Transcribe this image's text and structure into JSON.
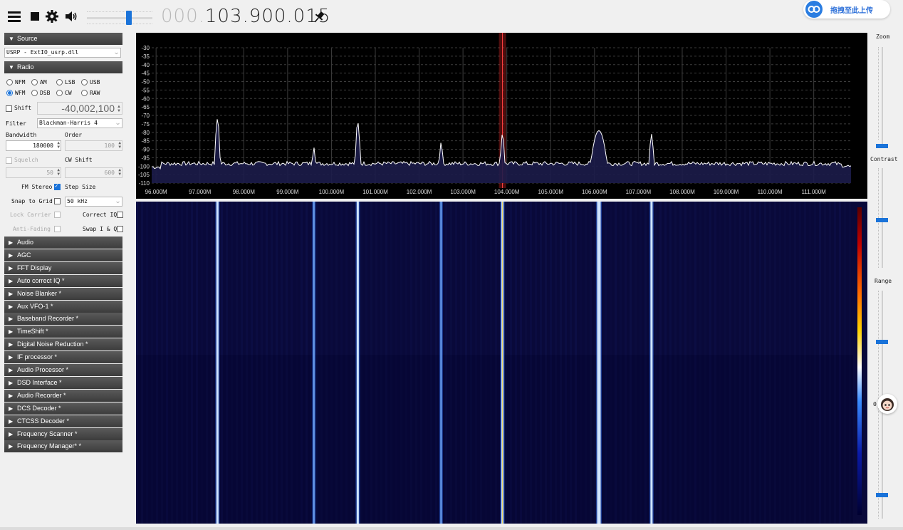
{
  "toolbar": {
    "frequency_dim": "000.",
    "frequency_main": "103.900.015",
    "upload_label": "拖拽至此上传"
  },
  "sidebar": {
    "source": {
      "header": "Source",
      "device": "USRP - ExtIO_usrp.dll"
    },
    "radio": {
      "header": "Radio",
      "modes": [
        "NFM",
        "AM",
        "LSB",
        "USB",
        "WFM",
        "DSB",
        "CW",
        "RAW"
      ],
      "selected_mode": "WFM",
      "shift_label": "Shift",
      "shift_value": "-40,002,100",
      "filter_label": "Filter",
      "filter_value": "Blackman-Harris 4",
      "bandwidth_label": "Bandwidth",
      "bandwidth_value": "180000",
      "order_label": "Order",
      "order_value": "100",
      "squelch_label": "Squelch",
      "squelch_value": "50",
      "cw_shift_label": "CW Shift",
      "cw_shift_value": "600",
      "fm_stereo_label": "FM Stereo",
      "step_size_label": "Step Size",
      "snap_label": "Snap to Grid",
      "step_size_value": "50 kHz",
      "lock_carrier_label": "Lock Carrier",
      "correct_iq_label": "Correct IQ",
      "anti_fading_label": "Anti-Fading",
      "swap_iq_label": "Swap I & Q"
    },
    "sections": [
      "Audio",
      "AGC",
      "FFT Display",
      "Auto correct IQ *",
      "Noise Blanker *",
      "Aux VFO-1 *",
      "Baseband Recorder *",
      "TimeShift *",
      "Digital Noise Reduction *",
      "IF processor *",
      "Audio Processor *",
      "DSD Interface *",
      "Audio Recorder *",
      "DCS Decoder *",
      "CTCSS Decoder *",
      "Frequency Scanner *",
      "Frequency Manager* *"
    ]
  },
  "right_panel": {
    "zoom_label": "Zoom",
    "contrast_label": "Contrast",
    "range_label": "Range",
    "colorbar_zero": "0"
  },
  "spectrum": {
    "db_ticks": [
      "-30",
      "-35",
      "-40",
      "-45",
      "-50",
      "-55",
      "-60",
      "-65",
      "-70",
      "-75",
      "-80",
      "-85",
      "-90",
      "-95",
      "-100",
      "-105",
      "-110"
    ],
    "freq_ticks": [
      "96.000M",
      "97.000M",
      "98.000M",
      "99.000M",
      "100.000M",
      "101.000M",
      "102.000M",
      "103.000M",
      "104.000M",
      "105.000M",
      "106.000M",
      "107.000M",
      "108.000M",
      "109.000M",
      "110.000M",
      "111.000M"
    ],
    "peaks": [
      {
        "freq": 97.4,
        "db": -72
      },
      {
        "freq": 99.6,
        "db": -89
      },
      {
        "freq": 100.6,
        "db": -74
      },
      {
        "freq": 102.5,
        "db": -86
      },
      {
        "freq": 103.9,
        "db": -81
      },
      {
        "freq": 106.1,
        "db": -79
      },
      {
        "freq": 107.3,
        "db": -81
      }
    ]
  },
  "colors": {
    "accent": "#1a73d9",
    "section_header": "#4a4a4a",
    "spectrum_bg": "#000000",
    "waterfall_bg": "#0a0a3c",
    "vfo_marker": "#b02020"
  }
}
